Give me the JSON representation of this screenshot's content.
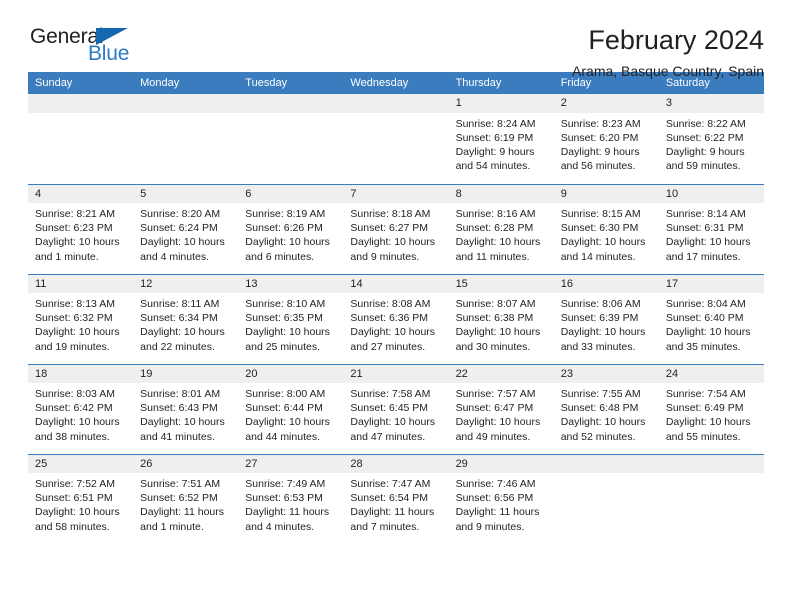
{
  "logo": {
    "word_one": "General",
    "word_two": "Blue",
    "triangle_color": "#1368b0",
    "blue_text_color": "#2b7cc4"
  },
  "header": {
    "title": "February 2024",
    "subtitle": "Arama, Basque Country, Spain"
  },
  "theme": {
    "header_blue": "#3a7cbe",
    "daynum_band": "#efefef",
    "text": "#231f20"
  },
  "calendar": {
    "weekday_headers": [
      "Sunday",
      "Monday",
      "Tuesday",
      "Wednesday",
      "Thursday",
      "Friday",
      "Saturday"
    ],
    "weeks": [
      [
        {
          "day": "",
          "empty": true,
          "lines": []
        },
        {
          "day": "",
          "empty": true,
          "lines": []
        },
        {
          "day": "",
          "empty": true,
          "lines": []
        },
        {
          "day": "",
          "empty": true,
          "lines": []
        },
        {
          "day": "1",
          "empty": false,
          "lines": [
            "Sunrise: 8:24 AM",
            "Sunset: 6:19 PM",
            "Daylight: 9 hours",
            "and 54 minutes."
          ]
        },
        {
          "day": "2",
          "empty": false,
          "lines": [
            "Sunrise: 8:23 AM",
            "Sunset: 6:20 PM",
            "Daylight: 9 hours",
            "and 56 minutes."
          ]
        },
        {
          "day": "3",
          "empty": false,
          "lines": [
            "Sunrise: 8:22 AM",
            "Sunset: 6:22 PM",
            "Daylight: 9 hours",
            "and 59 minutes."
          ]
        }
      ],
      [
        {
          "day": "4",
          "empty": false,
          "lines": [
            "Sunrise: 8:21 AM",
            "Sunset: 6:23 PM",
            "Daylight: 10 hours",
            "and 1 minute."
          ]
        },
        {
          "day": "5",
          "empty": false,
          "lines": [
            "Sunrise: 8:20 AM",
            "Sunset: 6:24 PM",
            "Daylight: 10 hours",
            "and 4 minutes."
          ]
        },
        {
          "day": "6",
          "empty": false,
          "lines": [
            "Sunrise: 8:19 AM",
            "Sunset: 6:26 PM",
            "Daylight: 10 hours",
            "and 6 minutes."
          ]
        },
        {
          "day": "7",
          "empty": false,
          "lines": [
            "Sunrise: 8:18 AM",
            "Sunset: 6:27 PM",
            "Daylight: 10 hours",
            "and 9 minutes."
          ]
        },
        {
          "day": "8",
          "empty": false,
          "lines": [
            "Sunrise: 8:16 AM",
            "Sunset: 6:28 PM",
            "Daylight: 10 hours",
            "and 11 minutes."
          ]
        },
        {
          "day": "9",
          "empty": false,
          "lines": [
            "Sunrise: 8:15 AM",
            "Sunset: 6:30 PM",
            "Daylight: 10 hours",
            "and 14 minutes."
          ]
        },
        {
          "day": "10",
          "empty": false,
          "lines": [
            "Sunrise: 8:14 AM",
            "Sunset: 6:31 PM",
            "Daylight: 10 hours",
            "and 17 minutes."
          ]
        }
      ],
      [
        {
          "day": "11",
          "empty": false,
          "lines": [
            "Sunrise: 8:13 AM",
            "Sunset: 6:32 PM",
            "Daylight: 10 hours",
            "and 19 minutes."
          ]
        },
        {
          "day": "12",
          "empty": false,
          "lines": [
            "Sunrise: 8:11 AM",
            "Sunset: 6:34 PM",
            "Daylight: 10 hours",
            "and 22 minutes."
          ]
        },
        {
          "day": "13",
          "empty": false,
          "lines": [
            "Sunrise: 8:10 AM",
            "Sunset: 6:35 PM",
            "Daylight: 10 hours",
            "and 25 minutes."
          ]
        },
        {
          "day": "14",
          "empty": false,
          "lines": [
            "Sunrise: 8:08 AM",
            "Sunset: 6:36 PM",
            "Daylight: 10 hours",
            "and 27 minutes."
          ]
        },
        {
          "day": "15",
          "empty": false,
          "lines": [
            "Sunrise: 8:07 AM",
            "Sunset: 6:38 PM",
            "Daylight: 10 hours",
            "and 30 minutes."
          ]
        },
        {
          "day": "16",
          "empty": false,
          "lines": [
            "Sunrise: 8:06 AM",
            "Sunset: 6:39 PM",
            "Daylight: 10 hours",
            "and 33 minutes."
          ]
        },
        {
          "day": "17",
          "empty": false,
          "lines": [
            "Sunrise: 8:04 AM",
            "Sunset: 6:40 PM",
            "Daylight: 10 hours",
            "and 35 minutes."
          ]
        }
      ],
      [
        {
          "day": "18",
          "empty": false,
          "lines": [
            "Sunrise: 8:03 AM",
            "Sunset: 6:42 PM",
            "Daylight: 10 hours",
            "and 38 minutes."
          ]
        },
        {
          "day": "19",
          "empty": false,
          "lines": [
            "Sunrise: 8:01 AM",
            "Sunset: 6:43 PM",
            "Daylight: 10 hours",
            "and 41 minutes."
          ]
        },
        {
          "day": "20",
          "empty": false,
          "lines": [
            "Sunrise: 8:00 AM",
            "Sunset: 6:44 PM",
            "Daylight: 10 hours",
            "and 44 minutes."
          ]
        },
        {
          "day": "21",
          "empty": false,
          "lines": [
            "Sunrise: 7:58 AM",
            "Sunset: 6:45 PM",
            "Daylight: 10 hours",
            "and 47 minutes."
          ]
        },
        {
          "day": "22",
          "empty": false,
          "lines": [
            "Sunrise: 7:57 AM",
            "Sunset: 6:47 PM",
            "Daylight: 10 hours",
            "and 49 minutes."
          ]
        },
        {
          "day": "23",
          "empty": false,
          "lines": [
            "Sunrise: 7:55 AM",
            "Sunset: 6:48 PM",
            "Daylight: 10 hours",
            "and 52 minutes."
          ]
        },
        {
          "day": "24",
          "empty": false,
          "lines": [
            "Sunrise: 7:54 AM",
            "Sunset: 6:49 PM",
            "Daylight: 10 hours",
            "and 55 minutes."
          ]
        }
      ],
      [
        {
          "day": "25",
          "empty": false,
          "lines": [
            "Sunrise: 7:52 AM",
            "Sunset: 6:51 PM",
            "Daylight: 10 hours",
            "and 58 minutes."
          ]
        },
        {
          "day": "26",
          "empty": false,
          "lines": [
            "Sunrise: 7:51 AM",
            "Sunset: 6:52 PM",
            "Daylight: 11 hours",
            "and 1 minute."
          ]
        },
        {
          "day": "27",
          "empty": false,
          "lines": [
            "Sunrise: 7:49 AM",
            "Sunset: 6:53 PM",
            "Daylight: 11 hours",
            "and 4 minutes."
          ]
        },
        {
          "day": "28",
          "empty": false,
          "lines": [
            "Sunrise: 7:47 AM",
            "Sunset: 6:54 PM",
            "Daylight: 11 hours",
            "and 7 minutes."
          ]
        },
        {
          "day": "29",
          "empty": false,
          "lines": [
            "Sunrise: 7:46 AM",
            "Sunset: 6:56 PM",
            "Daylight: 11 hours",
            "and 9 minutes."
          ]
        },
        {
          "day": "",
          "empty": true,
          "lines": []
        },
        {
          "day": "",
          "empty": true,
          "lines": []
        }
      ]
    ]
  }
}
